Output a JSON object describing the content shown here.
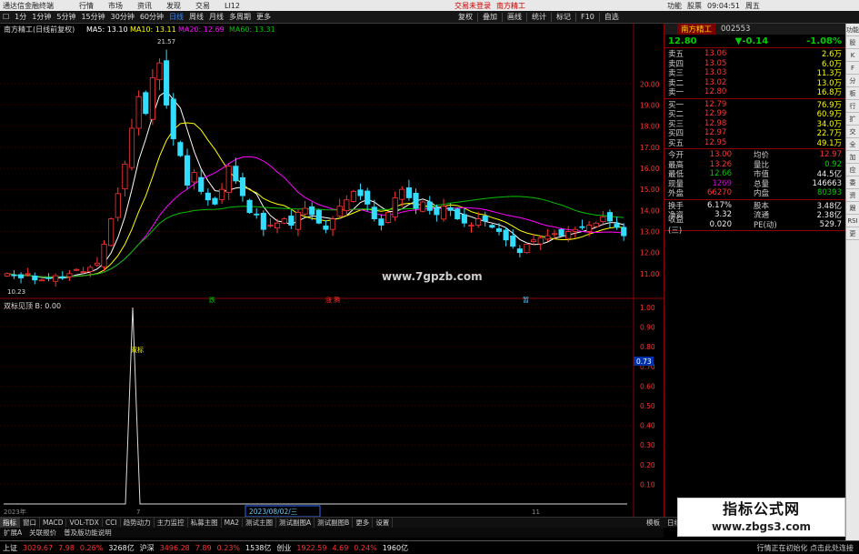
{
  "titlebar": {
    "app_title": "通达信金融终端",
    "menu": [
      "行情",
      "市场",
      "资讯",
      "发现",
      "交易",
      "LI12"
    ],
    "notice": "交易未登录",
    "stock": "南方精工",
    "right": [
      "功能",
      "股票",
      "09:04:51",
      "周五"
    ]
  },
  "toolbar": {
    "items": [
      "1分",
      "1分钟",
      "5分钟",
      "15分钟",
      "30分钟",
      "60分钟",
      "日线",
      "周线",
      "月线",
      "多周期",
      "更多"
    ],
    "active": "日线",
    "right_items": [
      "复权",
      "叠加",
      "画线",
      "统计",
      "标记",
      "F10",
      "自选"
    ]
  },
  "chart": {
    "main_title": "南方精工(日线前复权)",
    "ma": [
      {
        "label": "MA5: 13.10",
        "color": "#ffffff"
      },
      {
        "label": "MA10: 13.11",
        "color": "#ffff00"
      },
      {
        "label": "MA20: 12.69",
        "color": "#ff00ff"
      },
      {
        "label": "MA60: 13.31",
        "color": "#00c000"
      }
    ],
    "high_label": "21.57",
    "low_label": "10.23",
    "y_ticks": [
      "20.00",
      "19.00",
      "18.00",
      "17.00",
      "16.00",
      "15.00",
      "14.00",
      "13.00",
      "12.00",
      "11.00"
    ],
    "markers": [
      "跌",
      "涨 腾",
      "暂"
    ],
    "watermark_url": "www.7gpzb.com",
    "sub_title": "双标见顶 B: 0.00",
    "sub_label": "双标",
    "sub_y_ticks": [
      "1.00",
      "0.90",
      "0.80",
      "0.70",
      "0.60",
      "0.50",
      "0.40",
      "0.30",
      "0.20",
      "0.10"
    ],
    "sub_value": "0.73",
    "x_labels": [
      "2023年",
      "7",
      "2023/08/02/三",
      "11"
    ]
  },
  "quote": {
    "name": "南方精工",
    "code": "002553",
    "price": "12.80",
    "change": "▼-0.14",
    "pct": "-1.08%",
    "asks": [
      {
        "label": "卖五",
        "price": "13.06",
        "vol": "2.6万"
      },
      {
        "label": "卖四",
        "price": "13.05",
        "vol": "6.0万"
      },
      {
        "label": "卖三",
        "price": "13.03",
        "vol": "11.3万"
      },
      {
        "label": "卖二",
        "price": "13.02",
        "vol": "13.0万"
      },
      {
        "label": "卖一",
        "price": "12.80",
        "vol": "16.8万"
      }
    ],
    "bids": [
      {
        "label": "买一",
        "price": "12.79",
        "vol": "76.9万"
      },
      {
        "label": "买二",
        "price": "12.99",
        "vol": "60.9万"
      },
      {
        "label": "买三",
        "price": "12.98",
        "vol": "34.0万"
      },
      {
        "label": "买四",
        "price": "12.97",
        "vol": "22.7万"
      },
      {
        "label": "买五",
        "price": "12.95",
        "vol": "49.1万"
      }
    ],
    "stats": [
      {
        "l1": "今开",
        "v1": "13.00",
        "c1": "red",
        "l2": "均价",
        "v2": "12.97",
        "c2": "red"
      },
      {
        "l1": "最高",
        "v1": "13.26",
        "c1": "red",
        "l2": "量比",
        "v2": "0.92",
        "c2": "green"
      },
      {
        "l1": "最低",
        "v1": "12.66",
        "c1": "green",
        "l2": "市值",
        "v2": "44.5亿",
        "c2": "white"
      },
      {
        "l1": "现量",
        "v1": "1269",
        "c1": "purple",
        "l2": "总量",
        "v2": "146663",
        "c2": "white"
      },
      {
        "l1": "外盘",
        "v1": "66270",
        "c1": "red",
        "l2": "内盘",
        "v2": "80393",
        "c2": "green"
      }
    ],
    "stats2": [
      {
        "l1": "换手",
        "v1": "6.17%",
        "c1": "white",
        "l2": "股本",
        "v2": "3.48亿",
        "c2": "white"
      },
      {
        "l1": "净资",
        "v1": "3.32",
        "c1": "white",
        "l2": "流通",
        "v2": "2.38亿",
        "c2": "white"
      },
      {
        "l1": "收益(三)",
        "v1": "0.020",
        "c1": "white",
        "l2": "PE(动)",
        "v2": "529.7",
        "c2": "white"
      }
    ]
  },
  "right_sidebar": [
    "功能",
    "股",
    "K",
    "F",
    "分",
    "板",
    "行",
    "扩",
    "交",
    "全",
    "加",
    "应",
    "委",
    "资",
    "跟",
    "RSI",
    "更"
  ],
  "tabs": {
    "items": [
      "指标",
      "窗口",
      "MACD",
      "VOL-TDX",
      "CCI",
      "趋势动力",
      "主力监控",
      "私募主图",
      "MA2",
      "测试主图",
      "测试副图A",
      "测试副图B",
      "更多",
      "设置"
    ],
    "active": "指标",
    "tail": "模板",
    "period": "日线"
  },
  "substat": [
    "扩展A",
    "关联报价",
    "普及版功能说明"
  ],
  "statusbar": {
    "items": [
      {
        "t": "上证",
        "c": "white"
      },
      {
        "t": "3029.67",
        "c": "red"
      },
      {
        "t": "7.98",
        "c": "red"
      },
      {
        "t": "0.26%",
        "c": "red"
      },
      {
        "t": "3268亿",
        "c": "white"
      },
      {
        "t": "沪深",
        "c": "white"
      },
      {
        "t": "3496.28",
        "c": "red"
      },
      {
        "t": "7.89",
        "c": "red"
      },
      {
        "t": "0.23%",
        "c": "red"
      },
      {
        "t": "1538亿",
        "c": "white"
      },
      {
        "t": "创业",
        "c": "white"
      },
      {
        "t": "1922.59",
        "c": "red"
      },
      {
        "t": "4.69",
        "c": "red"
      },
      {
        "t": "0.24%",
        "c": "red"
      },
      {
        "t": "1960亿",
        "c": "white"
      }
    ],
    "message": "行情正在初始化 点击此处连接"
  },
  "banner": {
    "title": "指标公式网",
    "url": "www.zbgs3.com"
  },
  "chart_data": {
    "type": "candlestick",
    "title": "南方精工(日线前复权)",
    "ylim": [
      10,
      22
    ],
    "close": [
      11.0,
      10.9,
      10.8,
      11.0,
      10.7,
      10.7,
      10.8,
      10.9,
      10.8,
      11.0,
      11.2,
      11.1,
      11.3,
      11.5,
      12.4,
      13.6,
      14.8,
      16.2,
      17.9,
      19.4,
      18.6,
      20.3,
      21.0,
      19.0,
      17.4,
      16.6,
      15.2,
      15.8,
      14.9,
      14.5,
      14.3,
      15.0,
      16.1,
      15.4,
      14.7,
      13.9,
      13.8,
      13.1,
      13.3,
      13.4,
      13.6,
      13.3,
      13.9,
      14.1,
      13.8,
      13.4,
      13.1,
      13.6,
      14.2,
      14.5,
      14.9,
      14.7,
      14.3,
      13.6,
      13.3,
      13.9,
      14.6,
      15.0,
      14.6,
      14.1,
      14.4,
      14.0,
      13.8,
      14.2,
      14.0,
      13.6,
      13.4,
      13.3,
      13.6,
      13.5,
      13.2,
      13.0,
      12.6,
      12.3,
      12.0,
      12.4,
      12.6,
      12.7,
      12.8,
      12.9,
      12.8,
      13.0,
      13.1,
      13.2,
      13.3,
      13.4,
      13.7,
      13.5,
      13.2,
      12.8
    ]
  }
}
